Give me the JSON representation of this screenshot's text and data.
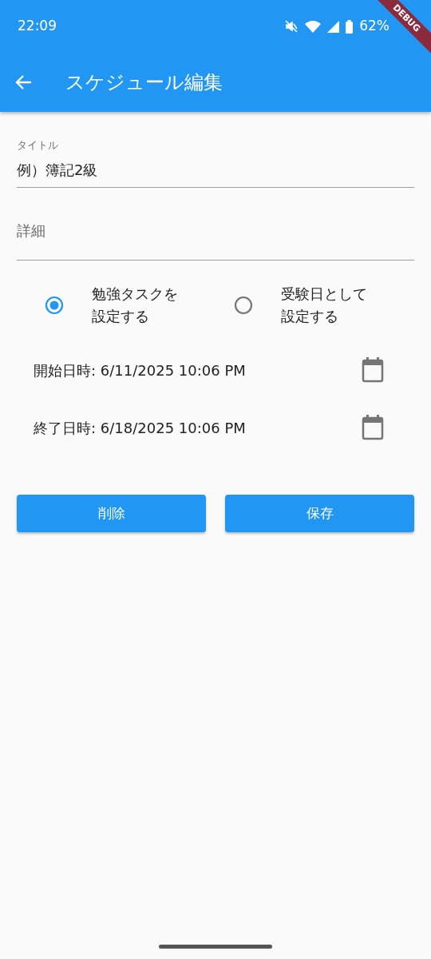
{
  "status_bar": {
    "time": "22:09",
    "battery": "62%"
  },
  "debug_banner": "DEBUG",
  "app_bar": {
    "title": "スケジュール編集"
  },
  "fields": [
    {
      "label": "タイトル",
      "value": "例）簿記2級"
    },
    {
      "placeholder": "詳細"
    }
  ],
  "radios": [
    {
      "label": "勉強タスクを設定する",
      "selected": true
    },
    {
      "label": "受験日として設定する",
      "selected": false
    }
  ],
  "dates": [
    {
      "text": "開始日時: 6/11/2025 10:06 PM"
    },
    {
      "text": "終了日時: 6/18/2025 10:06 PM"
    }
  ],
  "buttons": [
    {
      "label": "削除"
    },
    {
      "label": "保存"
    }
  ]
}
